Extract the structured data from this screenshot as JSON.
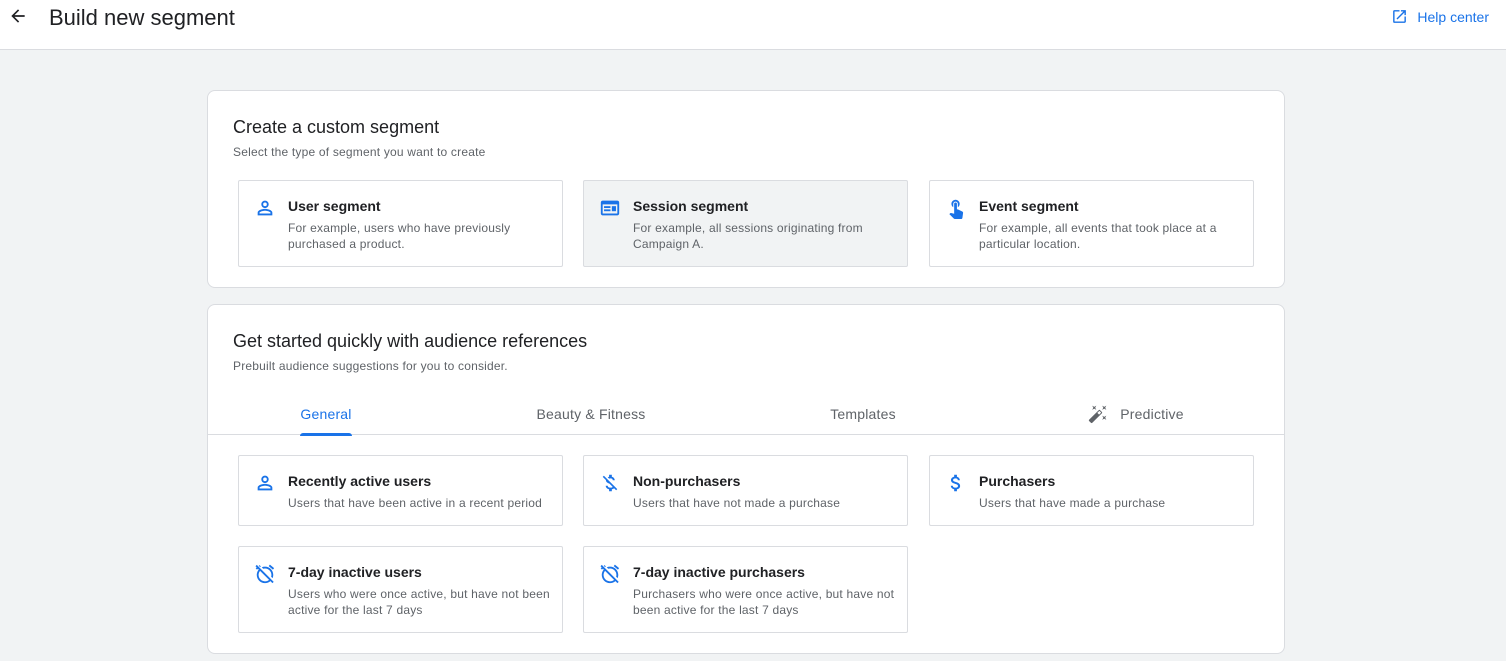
{
  "header": {
    "title": "Build new segment",
    "help_label": "Help center"
  },
  "custom_segment": {
    "title": "Create a custom segment",
    "subtitle": "Select the type of segment you want to create",
    "options": [
      {
        "icon": "person-icon",
        "title": "User segment",
        "desc": "For example, users who have previously purchased a product."
      },
      {
        "icon": "session-icon",
        "title": "Session segment",
        "desc": "For example, all sessions originating from Campaign A."
      },
      {
        "icon": "touch-icon",
        "title": "Event segment",
        "desc": "For example, all events that took place at a particular location."
      }
    ]
  },
  "audience_refs": {
    "title": "Get started quickly with audience references",
    "subtitle": "Prebuilt audience suggestions for you to consider.",
    "tabs": [
      {
        "label": "General",
        "active": true
      },
      {
        "label": "Beauty & Fitness",
        "active": false
      },
      {
        "label": "Templates",
        "active": false
      },
      {
        "label": "Predictive",
        "active": false,
        "icon": "magic-wand-icon"
      }
    ],
    "items": [
      {
        "icon": "person-icon",
        "title": "Recently active users",
        "desc": "Users that have been active in a recent period"
      },
      {
        "icon": "money-off-icon",
        "title": "Non-purchasers",
        "desc": "Users that have not made a purchase"
      },
      {
        "icon": "dollar-icon",
        "title": "Purchasers",
        "desc": "Users that have made a purchase"
      },
      {
        "icon": "alarm-off-icon",
        "title": "7-day inactive users",
        "desc": "Users who were once active, but have not been active for the last 7 days"
      },
      {
        "icon": "alarm-off-icon",
        "title": "7-day inactive purchasers",
        "desc": "Purchasers who were once active, but have not been active for the last 7 days"
      }
    ]
  },
  "colors": {
    "accent": "#1a73e8",
    "background": "#f1f3f4",
    "border": "#dadce0",
    "text_primary": "#202124",
    "text_secondary": "#5f6368"
  }
}
